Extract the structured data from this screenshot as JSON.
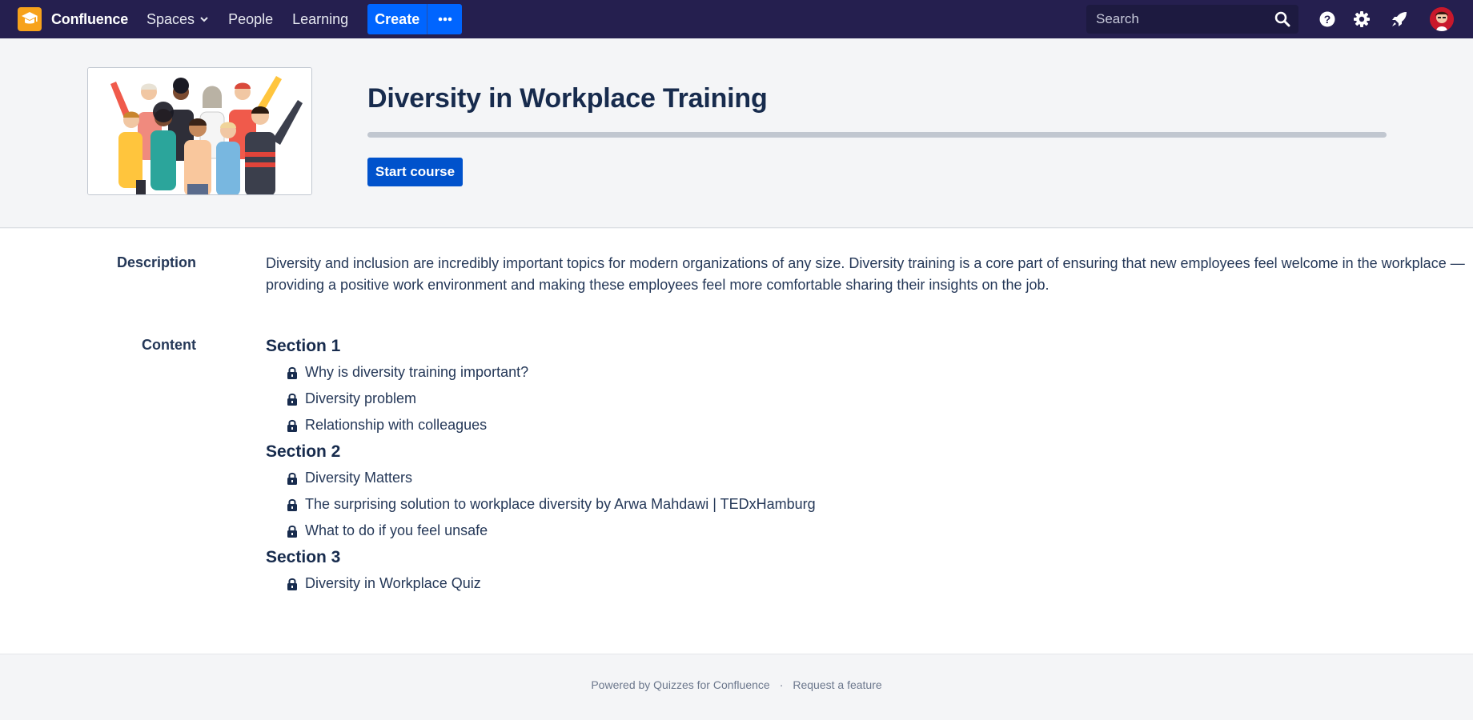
{
  "nav": {
    "brand": "Confluence",
    "items": [
      {
        "label": "Spaces",
        "has_dropdown": true
      },
      {
        "label": "People"
      },
      {
        "label": "Learning"
      }
    ],
    "create_label": "Create",
    "more_icon": "ellipsis-icon",
    "search_placeholder": "Search",
    "icons": [
      "help-icon",
      "settings-icon",
      "notifications-icon"
    ],
    "colors": {
      "bar": "#251f4f",
      "create": "#0065ff",
      "logo": "#f7a21b"
    }
  },
  "course": {
    "title": "Diversity in Workplace Training",
    "progress": 0,
    "start_label": "Start course",
    "cover_image": "diverse-group-of-people-illustration"
  },
  "details": {
    "description_label": "Description",
    "description": "Diversity and inclusion are incredibly important topics for modern organizations of any size. Diversity training is a core part of ensuring that new employees feel welcome in the workplace — providing a positive work environment and making these employees feel more comfortable sharing their insights on the job.",
    "content_label": "Content",
    "sections": [
      {
        "title": "Section 1",
        "lessons": [
          "Why is diversity training important?",
          "Diversity problem",
          "Relationship with colleagues"
        ]
      },
      {
        "title": "Section 2",
        "lessons": [
          "Diversity Matters",
          "The surprising solution to workplace diversity by Arwa Mahdawi | TEDxHamburg",
          "What to do if you feel unsafe"
        ]
      },
      {
        "title": "Section 3",
        "lessons": [
          "Diversity in Workplace Quiz"
        ]
      }
    ]
  },
  "footer": {
    "powered_by": "Powered by Quizzes for Confluence",
    "separator": "·",
    "request_feature": "Request a feature"
  }
}
